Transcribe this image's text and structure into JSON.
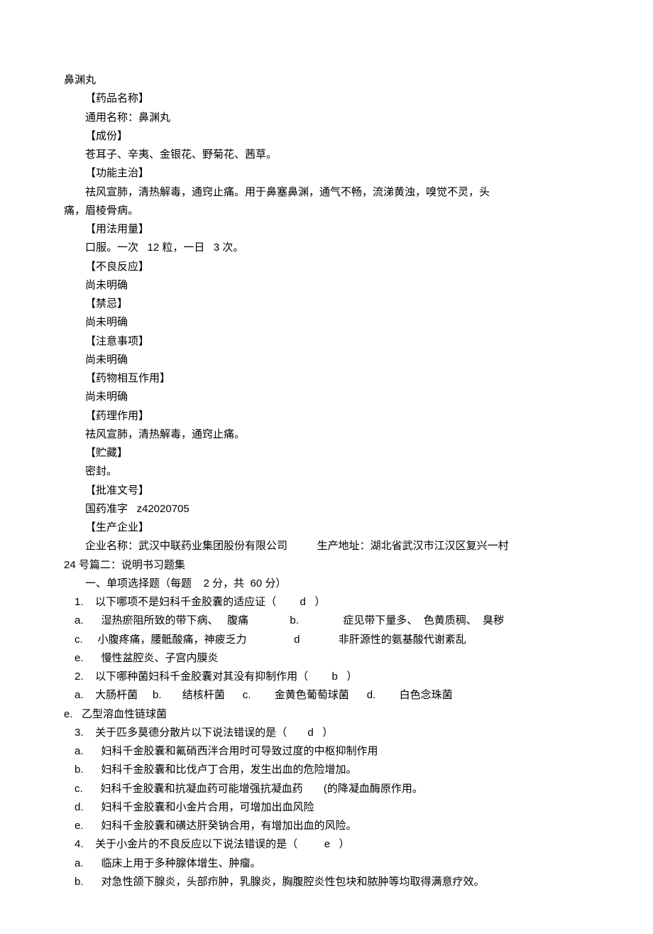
{
  "title": "鼻渊丸",
  "drug": {
    "heading_name": "【药品名称】",
    "common_name": "通用名称：鼻渊丸",
    "heading_ingredients": "【成份】",
    "ingredients": "苍耳子、辛夷、金银花、野菊花、茜草。",
    "heading_function": "【功能主治】",
    "function_part1": "祛风宣肺，清热解毒，通窍止痛。用于鼻塞鼻渊，通气不畅，流涕黄浊，嗅觉不灵，头",
    "function_part2": "痛，眉棱骨病。",
    "heading_usage": "【用法用量】",
    "usage": "口服。一次   12 粒，一日   3 次。",
    "heading_adverse": "【不良反应】",
    "adverse": "尚未明确",
    "heading_contra": "【禁忌】",
    "contra": "尚未明确",
    "heading_precaution": "【注意事项】",
    "precaution": "尚未明确",
    "heading_interaction": "【药物相互作用】",
    "interaction": "尚未明确",
    "heading_pharma": "【药理作用】",
    "pharma": "祛风宣肺，清热解毒，通窍止痛。",
    "heading_storage": "【贮藏】",
    "storage": "密封。",
    "heading_approval": "【批准文号】",
    "approval": "国药准字   z42020705",
    "heading_mfr": "【生产企业】",
    "mfr_part1": "企业名称：武汉中联药业集团股份有限公司          生产地址：湖北省武汉市江汉区复兴一村",
    "mfr_part2": "24 号篇二：说明书习题集"
  },
  "quiz": {
    "section_title": "一、单项选择题（每题    2 分，共  60 分）",
    "q1": "1.    以下哪项不是妇科千金胶囊的适应证（        d   ）",
    "q1a": "a.      湿热瘀阻所致的带下病、   腹痛              b.               症见带下量多、  色黄质稠、  臭秽",
    "q1c": "c.     小腹疼痛，腰骶酸痛，神疲乏力                d             非肝源性的氨基酸代谢紊乱",
    "q1e": "e.      慢性盆腔炎、子宫内膜炎",
    "q2": "2.    以下哪种菌妇科千金胶囊对其没有抑制作用（        b   ）",
    "q2a": "a.    大肠杆菌     b.       结核杆菌      c.        金黄色葡萄球菌      d.        白色念珠菌",
    "q2e": "e.   乙型溶血性链球菌",
    "q3": "3.    关于匹多莫德分散片以下说法错误的是（       d   ）",
    "q3a": "a.      妇科千金胶囊和氟硝西泮合用时可导致过度的中枢抑制作用",
    "q3b": "b.      妇科千金胶囊和比伐卢丁合用，发生出血的危险增加。",
    "q3c": "c.      妇科千金胶囊和抗凝血药可能增强抗凝血药       (的降凝血酶原作用。",
    "q3d": "d.      妇科千金胶囊和小金片合用，可增加出血风险",
    "q3e": "e.      妇科千金胶囊和磺达肝癸钠合用，有增加出血的风险。",
    "q4": "4.    关于小金片的不良反应以下说法错误的是（         e   ）",
    "q4a": "a.      临床上用于多种腺体增生、肿瘤。",
    "q4b": "b.      对急性颌下腺炎，头部疖肿，乳腺炎，胸腹腔炎性包块和脓肿等均取得满意疗效。"
  }
}
